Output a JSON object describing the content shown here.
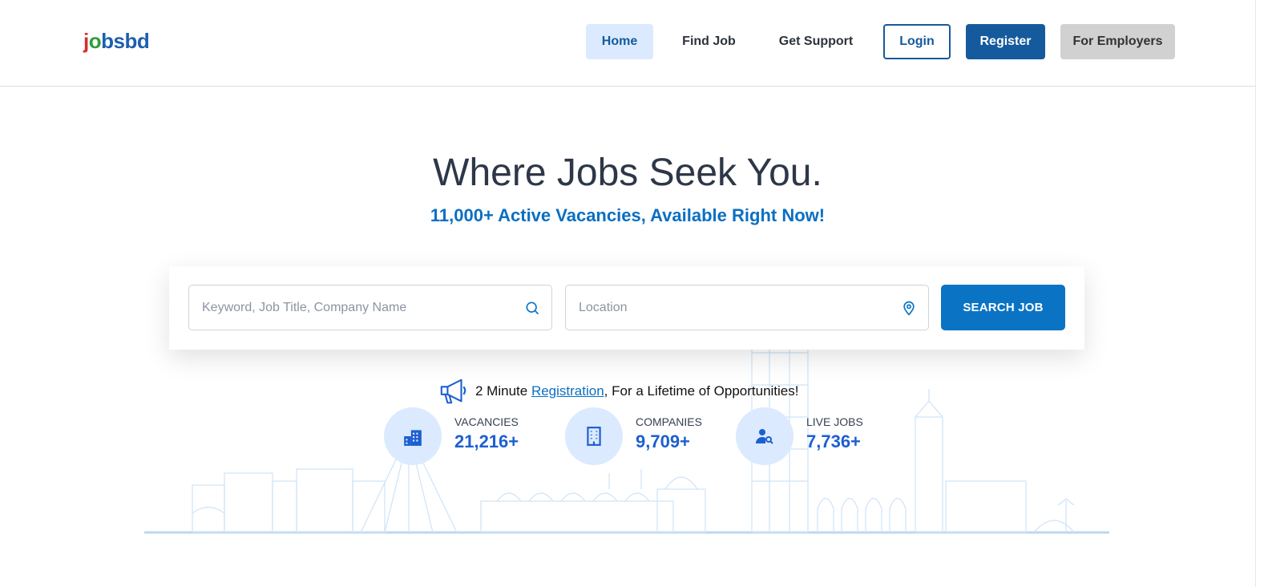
{
  "brand": {
    "logo_j": "j",
    "logo_o": "o",
    "logo_rest": "bsbd"
  },
  "nav": {
    "home": "Home",
    "find_job": "Find Job",
    "get_support": "Get Support",
    "login": "Login",
    "register": "Register",
    "for_employers": "For Employers"
  },
  "hero": {
    "title": "Where Jobs Seek You.",
    "subtitle": "11,000+ Active Vacancies, Available Right Now!"
  },
  "search": {
    "keyword_placeholder": "Keyword, Job Title, Company Name",
    "location_placeholder": "Location",
    "button": "SEARCH JOB"
  },
  "registration": {
    "prefix": "2 Minute ",
    "link": "Registration",
    "suffix": ", For a Lifetime of Opportunities!"
  },
  "stats": [
    {
      "label": "VACANCIES",
      "value": "21,216+",
      "icon": "buildings-icon"
    },
    {
      "label": "COMPANIES",
      "value": "9,709+",
      "icon": "office-building-icon"
    },
    {
      "label": "LIVE JOBS",
      "value": "7,736+",
      "icon": "user-search-icon"
    }
  ],
  "colors": {
    "primary": "#155a9c",
    "accent": "#0a73c4",
    "stat_number": "#1d5fd0",
    "stat_circle": "#dbeafe"
  }
}
